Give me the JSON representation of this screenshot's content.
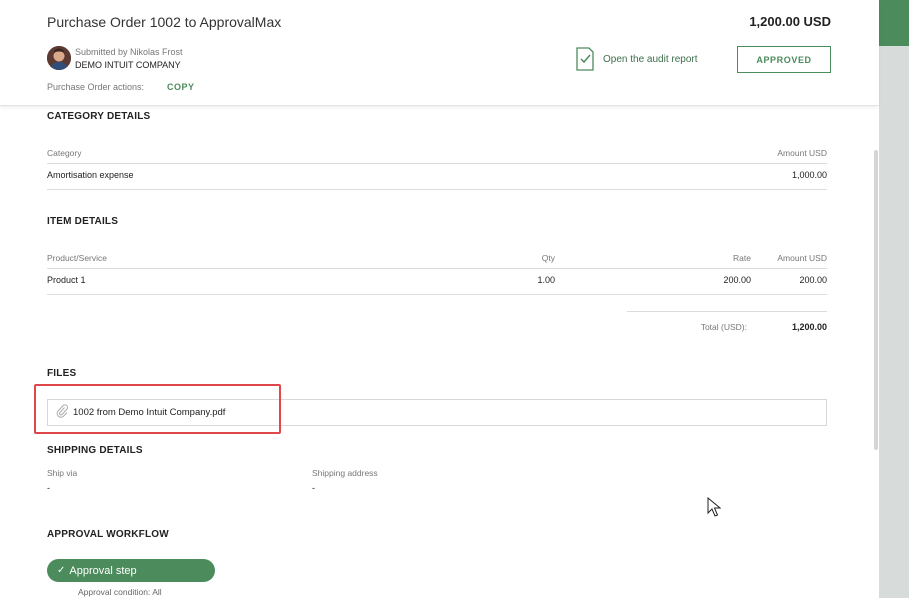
{
  "header": {
    "title": "Purchase Order 1002 to ApprovalMax",
    "amount": "1,200.00 USD",
    "submitted_by": "Submitted by Nikolas Frost",
    "company": "DEMO INTUIT COMPANY",
    "actions_label": "Purchase Order actions:",
    "copy_label": "COPY",
    "audit_label": "Open the audit report",
    "status_button": "APPROVED"
  },
  "category_details": {
    "title": "CATEGORY DETAILS",
    "columns": [
      "Category",
      "Amount USD"
    ],
    "rows": [
      {
        "category": "Amortisation expense",
        "amount": "1,000.00"
      }
    ]
  },
  "item_details": {
    "title": "ITEM DETAILS",
    "columns": [
      "Product/Service",
      "Qty",
      "Rate",
      "Amount USD"
    ],
    "rows": [
      {
        "product": "Product 1",
        "qty": "1.00",
        "rate": "200.00",
        "amount": "200.00"
      }
    ],
    "total_label": "Total (USD):",
    "total_value": "1,200.00"
  },
  "files": {
    "title": "FILES",
    "items": [
      "1002 from Demo Intuit Company.pdf"
    ]
  },
  "shipping": {
    "title": "SHIPPING DETAILS",
    "ship_via_label": "Ship via",
    "ship_via_value": "-",
    "address_label": "Shipping address",
    "address_value": "-"
  },
  "workflow": {
    "title": "APPROVAL WORKFLOW",
    "step_label": "Approval step",
    "condition": "Approval condition: All"
  },
  "colors": {
    "accent": "#4c8b5c",
    "highlight": "#e0474b",
    "side_panel": "#d7dcdb"
  }
}
